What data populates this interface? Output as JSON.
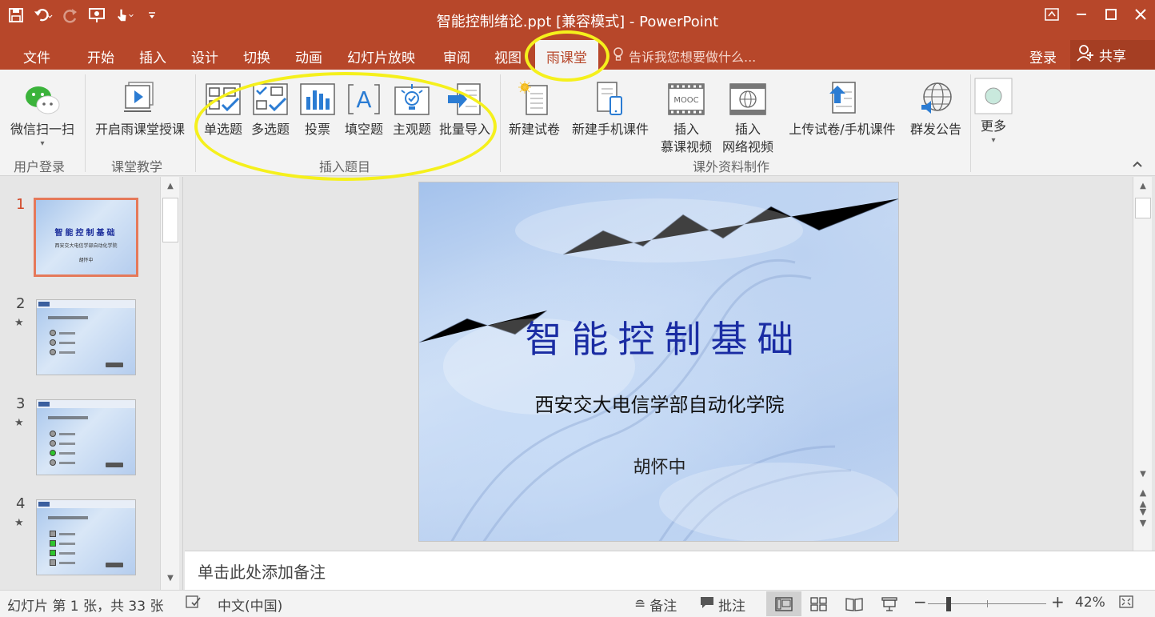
{
  "window": {
    "title": "智能控制绪论.ppt [兼容模式] - PowerPoint"
  },
  "tabs": {
    "file": "文件",
    "home": "开始",
    "insert": "插入",
    "design": "设计",
    "transitions": "切换",
    "animations": "动画",
    "slideshow": "幻灯片放映",
    "review": "审阅",
    "view": "视图",
    "yuketang": "雨课堂",
    "tellme": "告诉我您想要做什么...",
    "login": "登录",
    "share": "共享"
  },
  "ribbon": {
    "wechat_scan": "微信扫一扫",
    "start_class": "开启雨课堂授课",
    "single_choice": "单选题",
    "multi_choice": "多选题",
    "vote": "投票",
    "fill_blank": "填空题",
    "subjective": "主观题",
    "batch_import": "批量导入",
    "new_paper": "新建试卷",
    "new_mobile": "新建手机课件",
    "insert_mooc_1": "插入",
    "insert_mooc_2": "慕课视频",
    "insert_web_1": "插入",
    "insert_web_2": "网络视频",
    "upload": "上传试卷/手机课件",
    "announce": "群发公告",
    "more": "更多",
    "mooc_badge": "MOOC",
    "groups": {
      "user_login": "用户登录",
      "teaching": "课堂教学",
      "insert_questions": "插入题目",
      "materials": "课外资料制作"
    }
  },
  "thumbnails": [
    {
      "num": "1",
      "title": "智能控制基础",
      "sub": "西安交大电信学部自动化学院",
      "author": "胡怀中"
    },
    {
      "num": "2",
      "star": "★"
    },
    {
      "num": "3",
      "star": "★"
    },
    {
      "num": "4",
      "star": "★"
    }
  ],
  "slide": {
    "title": "智能控制基础",
    "subtitle": "西安交大电信学部自动化学院",
    "author": "胡怀中"
  },
  "notes": {
    "placeholder": "单击此处添加备注"
  },
  "status": {
    "slide_info": "幻灯片 第 1 张，共 33 张",
    "language": "中文(中国)",
    "notes": "备注",
    "comments": "批注",
    "zoom": "42%",
    "zoom_level": 0.42
  },
  "colors": {
    "accent": "#b7472a",
    "highlight": "#f5f01c",
    "slide_title": "#1a2ca3"
  }
}
